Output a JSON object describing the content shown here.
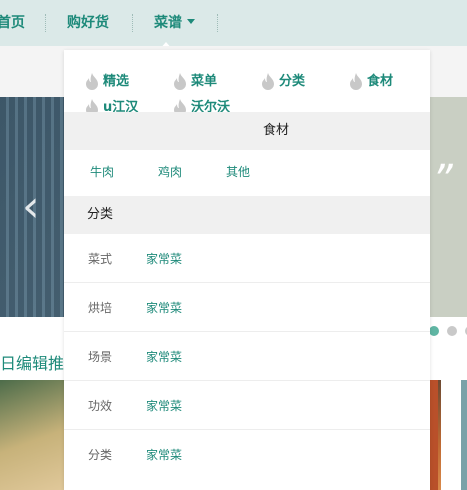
{
  "nav": {
    "items": [
      {
        "label": "首页"
      },
      {
        "label": "购好货"
      },
      {
        "label": "菜谱"
      }
    ]
  },
  "background": {
    "section_title": "日编辑推荐"
  },
  "dropdown": {
    "tags": [
      {
        "label": "精选",
        "icon": "flame-icon"
      },
      {
        "label": "菜单",
        "icon": "flame-icon"
      },
      {
        "label": "分类",
        "icon": "flame-icon"
      },
      {
        "label": "食材",
        "icon": "flame-icon"
      },
      {
        "label": "u江汉",
        "icon": "flame-icon"
      },
      {
        "label": "沃尔沃",
        "icon": "flame-icon"
      }
    ],
    "ingredients": {
      "title": "食材",
      "links": [
        "牛肉",
        "鸡肉",
        "其他"
      ]
    },
    "categories": {
      "title": "分类",
      "rows": [
        {
          "label": "菜式",
          "link": "家常菜"
        },
        {
          "label": "烘培",
          "link": "家常菜"
        },
        {
          "label": "场景",
          "link": "家常菜"
        },
        {
          "label": "功效",
          "link": "家常菜"
        },
        {
          "label": "分类",
          "link": "家常菜"
        }
      ]
    }
  },
  "colors": {
    "accent": "#1e8a7a",
    "nav_bg": "#dbe9e8",
    "band_bg": "#f0f0f0",
    "active_dot": "#5fb5a3"
  }
}
